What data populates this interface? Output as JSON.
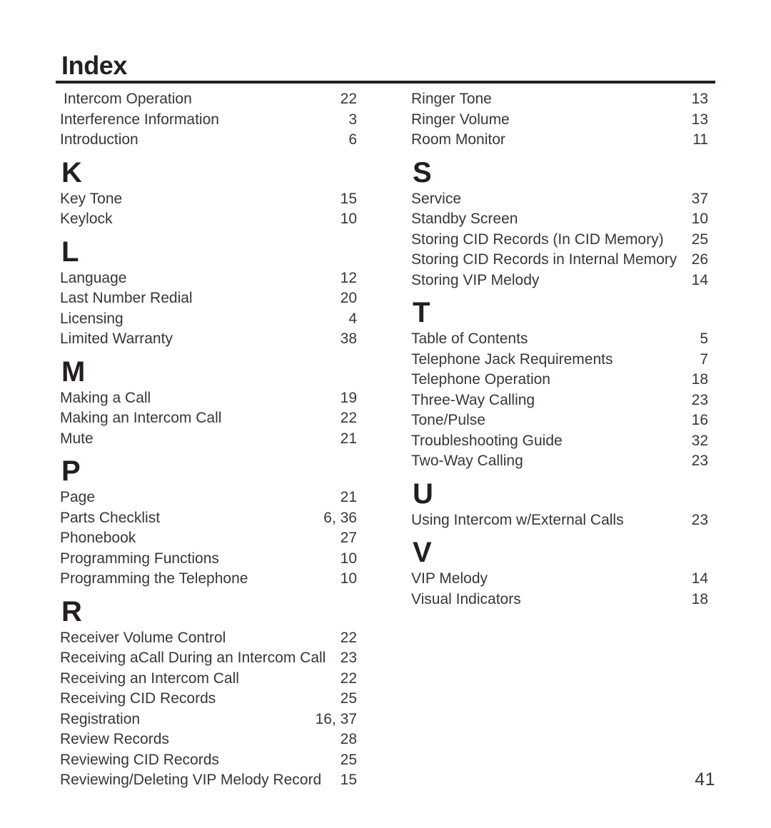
{
  "document": {
    "title": "Index",
    "folio": "41"
  },
  "columns": {
    "left": [
      {
        "type": "entries",
        "entries": [
          {
            "label": " Intercom Operation",
            "page": "22"
          },
          {
            "label": "Interference Information",
            "page": "3"
          },
          {
            "label": "Introduction",
            "page": "6"
          }
        ]
      },
      {
        "type": "section",
        "letter": "K",
        "entries": [
          {
            "label": "Key Tone",
            "page": "15"
          },
          {
            "label": "Keylock",
            "page": "10"
          }
        ]
      },
      {
        "type": "section",
        "letter": "L",
        "entries": [
          {
            "label": "Language",
            "page": "12"
          },
          {
            "label": "Last Number Redial",
            "page": "20"
          },
          {
            "label": "Licensing",
            "page": "4"
          },
          {
            "label": "Limited Warranty",
            "page": "38"
          }
        ]
      },
      {
        "type": "section",
        "letter": "M",
        "entries": [
          {
            "label": "Making a Call",
            "page": "19"
          },
          {
            "label": "Making an Intercom Call",
            "page": "22"
          },
          {
            "label": "Mute",
            "page": "21"
          }
        ]
      },
      {
        "type": "section",
        "letter": "P",
        "entries": [
          {
            "label": "Page",
            "page": "21"
          },
          {
            "label": "Parts Checklist",
            "page": "6, 36"
          },
          {
            "label": "Phonebook",
            "page": "27"
          },
          {
            "label": "Programming Functions",
            "page": "10"
          },
          {
            "label": "Programming the Telephone",
            "page": "10"
          }
        ]
      },
      {
        "type": "section",
        "letter": "R",
        "entries": [
          {
            "label": "Receiver Volume Control",
            "page": "22"
          },
          {
            "label": "Receiving aCall During an Intercom Call",
            "page": "23"
          },
          {
            "label": "Receiving an Intercom Call",
            "page": "22"
          },
          {
            "label": "Receiving CID Records",
            "page": "25"
          },
          {
            "label": "Registration",
            "page": "16, 37"
          },
          {
            "label": "Review Records",
            "page": "28"
          },
          {
            "label": "Reviewing CID Records",
            "page": "25"
          },
          {
            "label": "Reviewing/Deleting VIP Melody Record",
            "page": "15"
          }
        ]
      }
    ],
    "right": [
      {
        "type": "entries",
        "entries": [
          {
            "label": "Ringer Tone",
            "page": "13"
          },
          {
            "label": "Ringer Volume",
            "page": "13"
          },
          {
            "label": "Room Monitor",
            "page": "11"
          }
        ]
      },
      {
        "type": "section",
        "letter": "S",
        "entries": [
          {
            "label": "Service",
            "page": "37"
          },
          {
            "label": "Standby Screen",
            "page": "10"
          },
          {
            "label": "Storing CID Records (In CID Memory)",
            "page": "25"
          },
          {
            "label": "Storing CID Records in Internal Memory",
            "page": "26"
          },
          {
            "label": "Storing VIP Melody",
            "page": "14"
          }
        ]
      },
      {
        "type": "section",
        "letter": "T",
        "entries": [
          {
            "label": "Table of Contents",
            "page": "5"
          },
          {
            "label": "Telephone Jack Requirements",
            "page": "7"
          },
          {
            "label": "Telephone Operation",
            "page": "18"
          },
          {
            "label": "Three-Way Calling",
            "page": "23"
          },
          {
            "label": "Tone/Pulse",
            "page": "16"
          },
          {
            "label": "Troubleshooting Guide",
            "page": "32"
          },
          {
            "label": "Two-Way Calling",
            "page": "23"
          }
        ]
      },
      {
        "type": "section",
        "letter": "U",
        "entries": [
          {
            "label": "Using Intercom w/External Calls",
            "page": "23"
          }
        ]
      },
      {
        "type": "section",
        "letter": "V",
        "entries": [
          {
            "label": "VIP Melody",
            "page": "14"
          },
          {
            "label": "Visual Indicators",
            "page": "18"
          }
        ]
      }
    ]
  }
}
